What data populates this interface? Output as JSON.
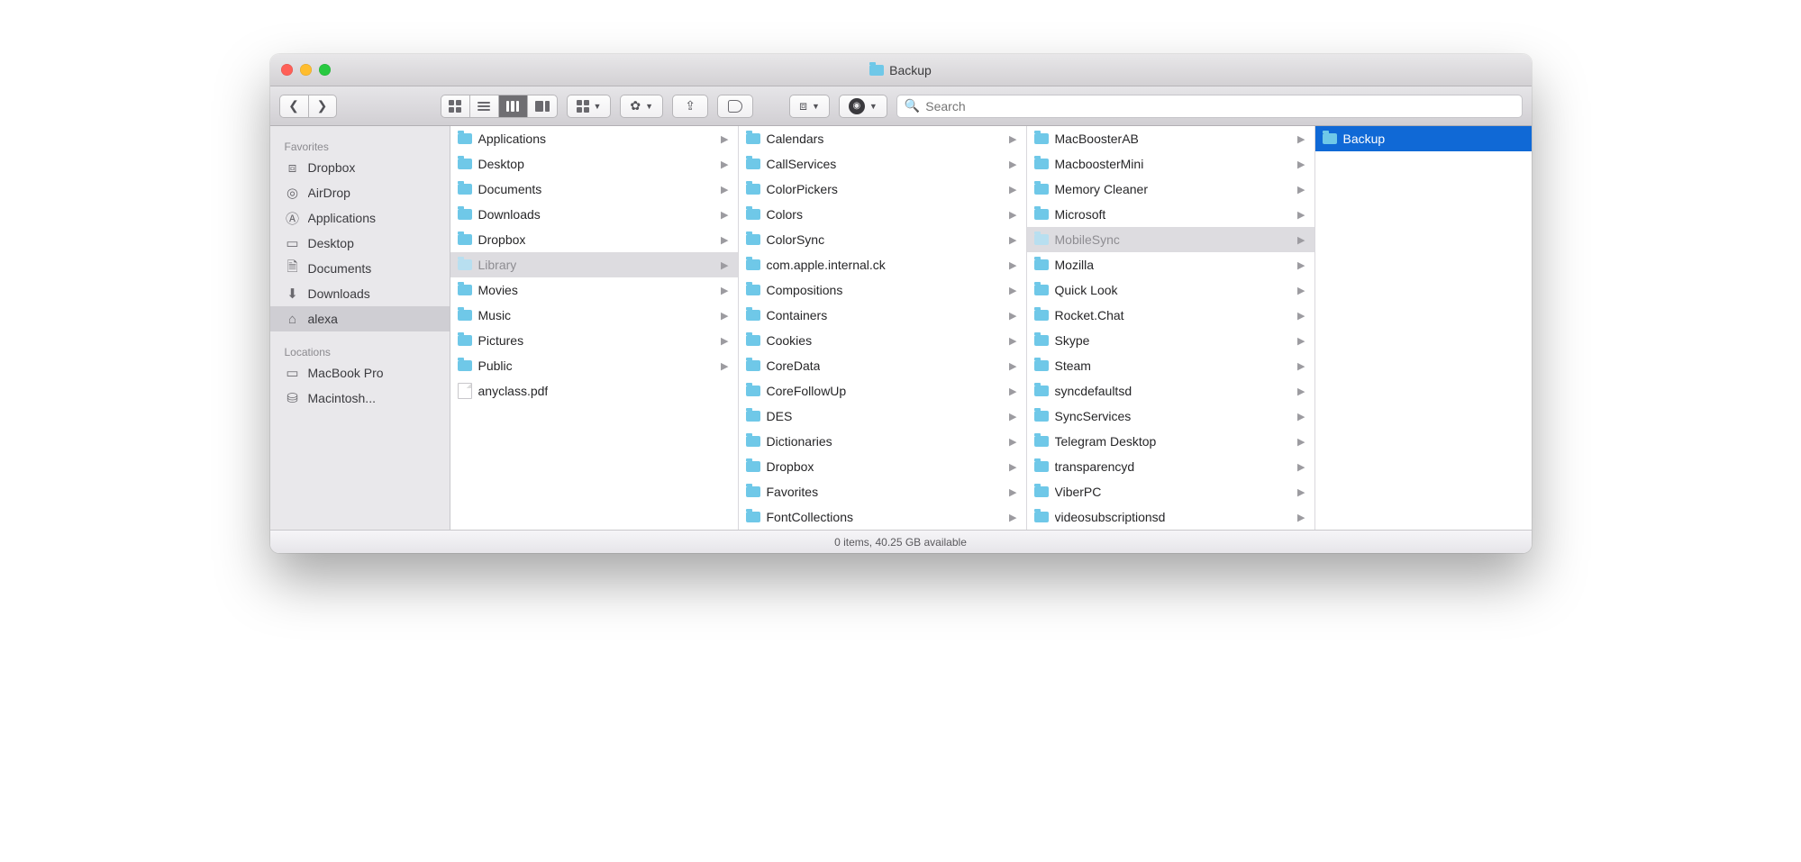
{
  "window": {
    "title": "Backup"
  },
  "search": {
    "placeholder": "Search"
  },
  "sidebar": {
    "sections": [
      {
        "label": "Favorites",
        "items": [
          {
            "icon": "dropbox",
            "label": "Dropbox"
          },
          {
            "icon": "airdrop",
            "label": "AirDrop"
          },
          {
            "icon": "apps",
            "label": "Applications"
          },
          {
            "icon": "desktop",
            "label": "Desktop"
          },
          {
            "icon": "documents",
            "label": "Documents"
          },
          {
            "icon": "downloads",
            "label": "Downloads"
          },
          {
            "icon": "home",
            "label": "alexa",
            "selected": true
          }
        ]
      },
      {
        "label": "Locations",
        "items": [
          {
            "icon": "laptop",
            "label": "MacBook Pro"
          },
          {
            "icon": "disk",
            "label": "Macintosh..."
          }
        ]
      }
    ]
  },
  "columns": [
    [
      {
        "type": "folder",
        "name": "Applications",
        "arrow": true
      },
      {
        "type": "folder",
        "name": "Desktop",
        "arrow": true
      },
      {
        "type": "folder",
        "name": "Documents",
        "arrow": true
      },
      {
        "type": "folder",
        "name": "Downloads",
        "arrow": true
      },
      {
        "type": "folder",
        "name": "Dropbox",
        "arrow": true
      },
      {
        "type": "folder",
        "name": "Library",
        "arrow": true,
        "selectedPath": true
      },
      {
        "type": "folder",
        "name": "Movies",
        "arrow": true
      },
      {
        "type": "folder",
        "name": "Music",
        "arrow": true
      },
      {
        "type": "folder",
        "name": "Pictures",
        "arrow": true
      },
      {
        "type": "folder",
        "name": "Public",
        "arrow": true
      },
      {
        "type": "pdf",
        "name": "anyclass.pdf",
        "arrow": false
      }
    ],
    [
      {
        "type": "folder",
        "name": "Calendars",
        "arrow": true
      },
      {
        "type": "folder",
        "name": "CallServices",
        "arrow": true
      },
      {
        "type": "folder",
        "name": "ColorPickers",
        "arrow": true
      },
      {
        "type": "folder",
        "name": "Colors",
        "arrow": true
      },
      {
        "type": "folder",
        "name": "ColorSync",
        "arrow": true
      },
      {
        "type": "folder",
        "name": "com.apple.internal.ck",
        "arrow": true
      },
      {
        "type": "folder",
        "name": "Compositions",
        "arrow": true
      },
      {
        "type": "folder",
        "name": "Containers",
        "arrow": true
      },
      {
        "type": "folder",
        "name": "Cookies",
        "arrow": true
      },
      {
        "type": "folder",
        "name": "CoreData",
        "arrow": true
      },
      {
        "type": "folder",
        "name": "CoreFollowUp",
        "arrow": true
      },
      {
        "type": "folder",
        "name": "DES",
        "arrow": true
      },
      {
        "type": "folder",
        "name": "Dictionaries",
        "arrow": true
      },
      {
        "type": "folder",
        "name": "Dropbox",
        "arrow": true
      },
      {
        "type": "folder",
        "name": "Favorites",
        "arrow": true
      },
      {
        "type": "folder",
        "name": "FontCollections",
        "arrow": true
      }
    ],
    [
      {
        "type": "folder",
        "name": "MacBoosterAB",
        "arrow": true
      },
      {
        "type": "folder",
        "name": "MacboosterMini",
        "arrow": true
      },
      {
        "type": "folder",
        "name": "Memory Cleaner",
        "arrow": true
      },
      {
        "type": "folder",
        "name": "Microsoft",
        "arrow": true
      },
      {
        "type": "folder",
        "name": "MobileSync",
        "arrow": true,
        "selectedPath": true
      },
      {
        "type": "folder",
        "name": "Mozilla",
        "arrow": true
      },
      {
        "type": "folder",
        "name": "Quick Look",
        "arrow": true
      },
      {
        "type": "folder",
        "name": "Rocket.Chat",
        "arrow": true
      },
      {
        "type": "folder",
        "name": "Skype",
        "arrow": true
      },
      {
        "type": "folder",
        "name": "Steam",
        "arrow": true
      },
      {
        "type": "folder",
        "name": "syncdefaultsd",
        "arrow": true
      },
      {
        "type": "folder",
        "name": "SyncServices",
        "arrow": true
      },
      {
        "type": "folder",
        "name": "Telegram Desktop",
        "arrow": true
      },
      {
        "type": "folder",
        "name": "transparencyd",
        "arrow": true
      },
      {
        "type": "folder",
        "name": "ViberPC",
        "arrow": true
      },
      {
        "type": "folder",
        "name": "videosubscriptionsd",
        "arrow": true
      }
    ],
    [
      {
        "type": "folder",
        "name": "Backup",
        "arrow": false,
        "selectedActive": true
      }
    ]
  ],
  "status": "0 items, 40.25 GB available"
}
